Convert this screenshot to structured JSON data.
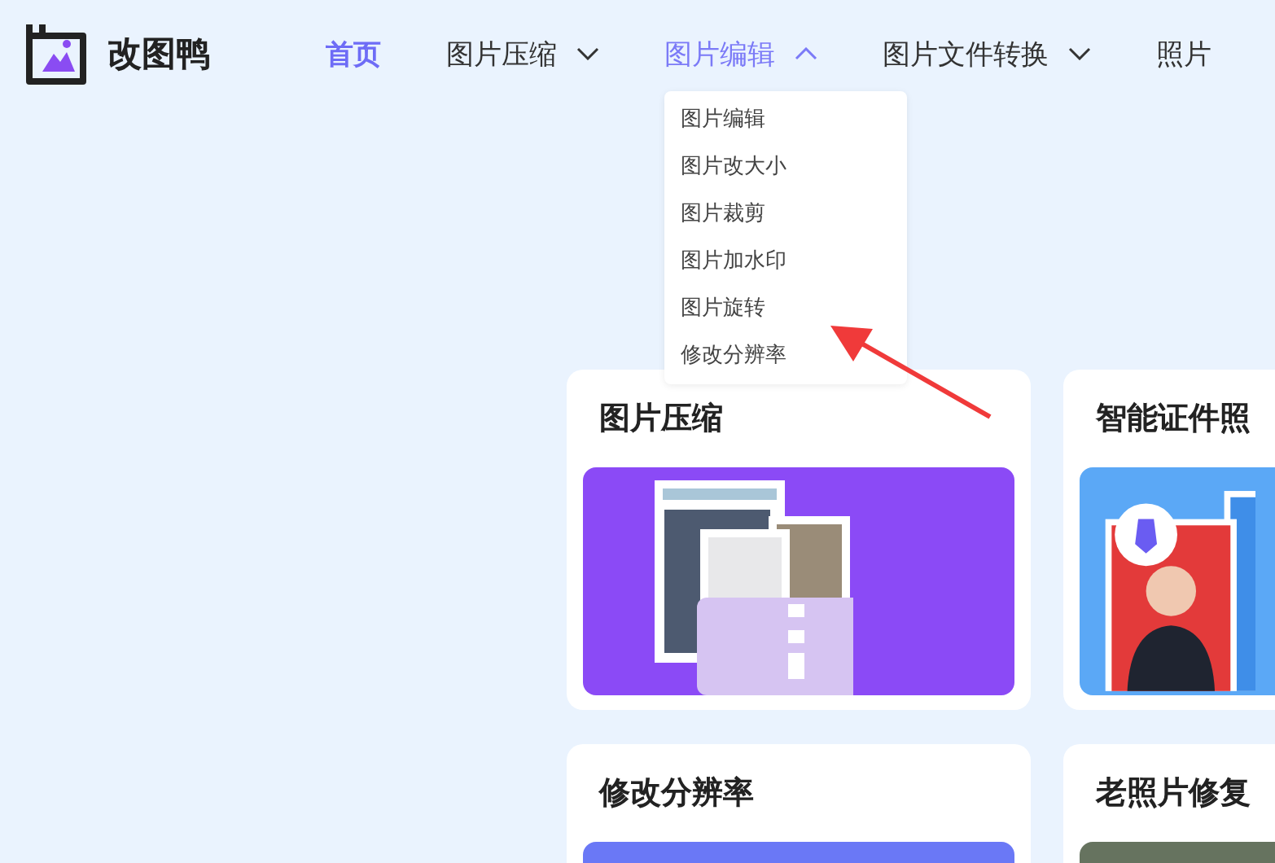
{
  "logo": {
    "name": "改图鸭"
  },
  "nav": [
    {
      "label": "首页",
      "selected": true,
      "has_menu": false,
      "expanded": false
    },
    {
      "label": "图片压缩",
      "selected": false,
      "has_menu": true,
      "expanded": false
    },
    {
      "label": "图片编辑",
      "selected": false,
      "has_menu": true,
      "expanded": true,
      "menu": [
        "图片编辑",
        "图片改大小",
        "图片裁剪",
        "图片加水印",
        "图片旋转",
        "修改分辨率"
      ]
    },
    {
      "label": "图片文件转换",
      "selected": false,
      "has_menu": true,
      "expanded": false
    },
    {
      "label": "照片",
      "selected": false,
      "has_menu": false,
      "expanded": false
    }
  ],
  "cards": [
    {
      "title": "图片压缩",
      "kind": "compress"
    },
    {
      "title": "智能证件照",
      "kind": "id_photo"
    },
    {
      "title": "修改分辨率",
      "kind": "resolution"
    },
    {
      "title": "老照片修复",
      "kind": "restore"
    }
  ]
}
